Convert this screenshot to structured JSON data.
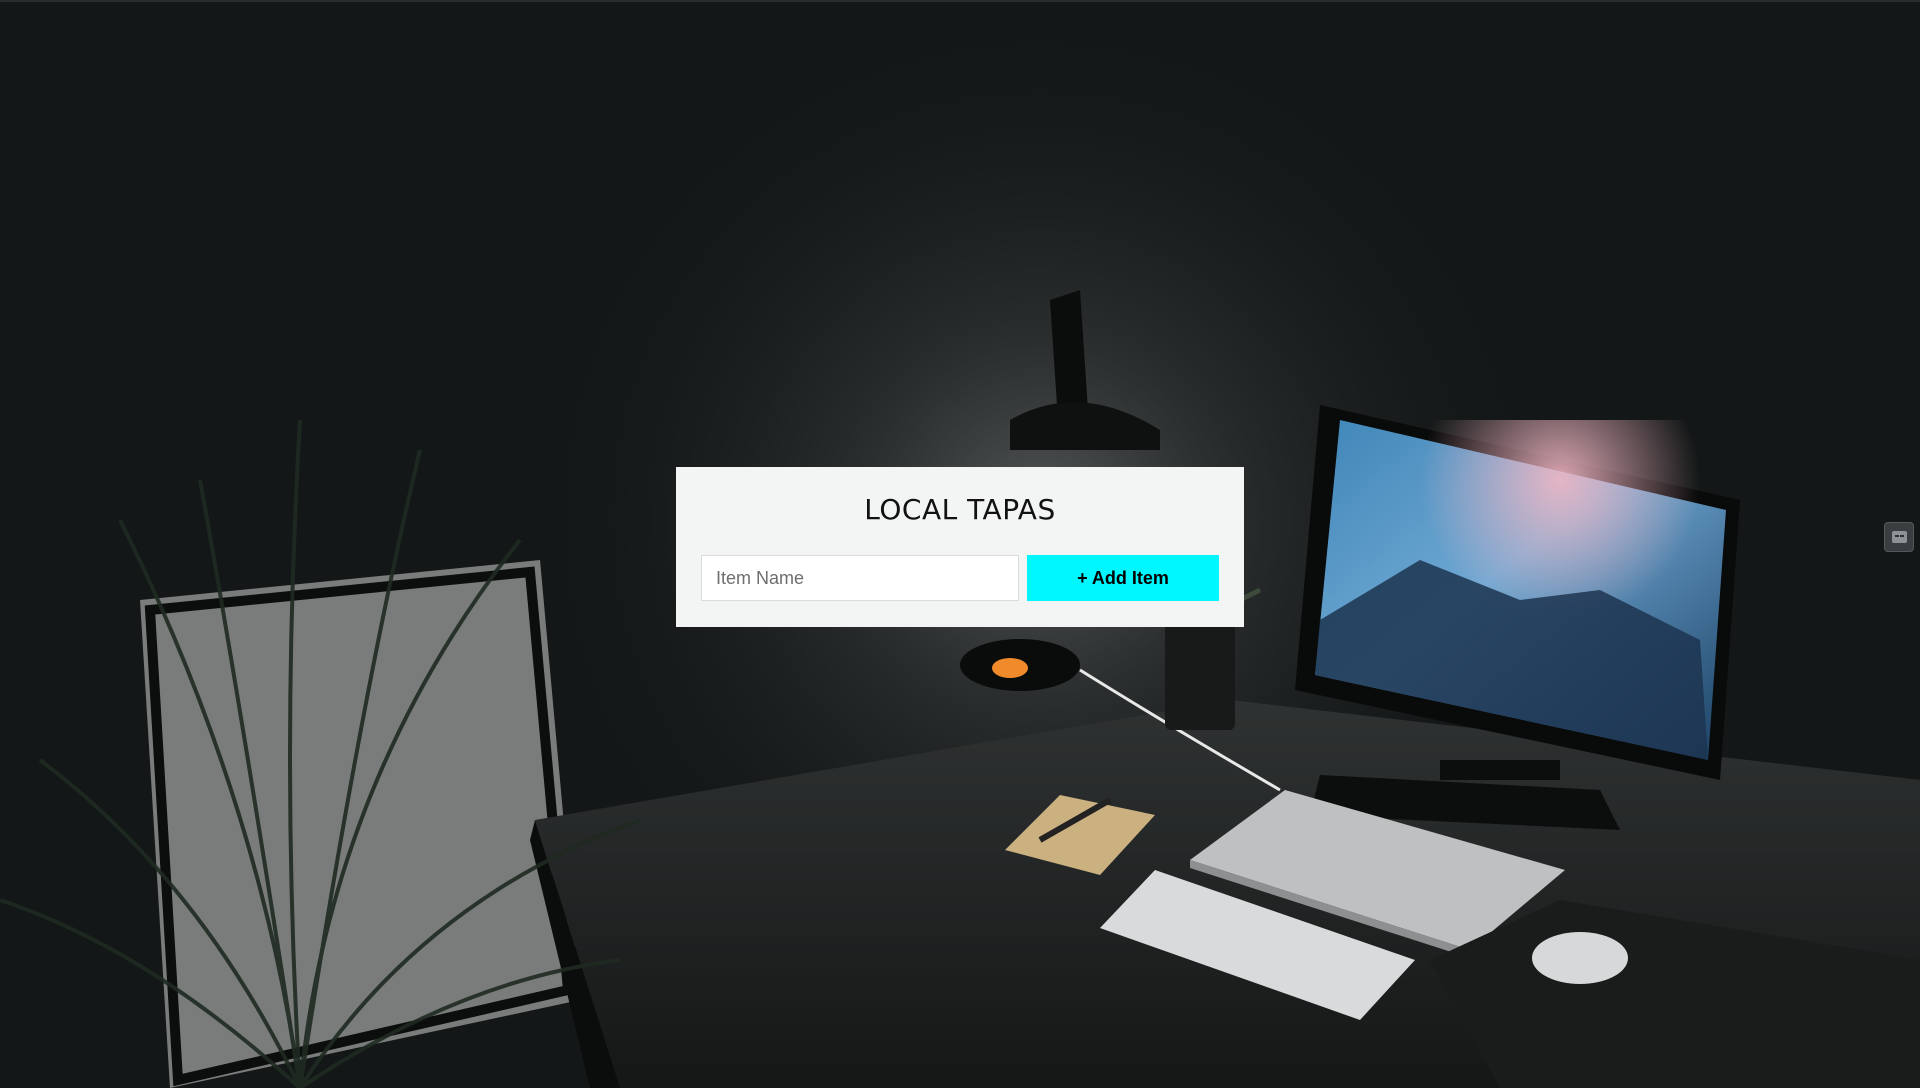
{
  "app": {
    "title": "LOCAL TAPAS"
  },
  "form": {
    "item_input": {
      "value": "",
      "placeholder": "Item Name"
    },
    "add_button_label": "+ Add Item"
  },
  "colors": {
    "accent": "#00f7ff",
    "card_background": "#f3f4f4",
    "page_background": "#141818"
  },
  "icons": {
    "side_widget": "chat-widget-icon"
  }
}
